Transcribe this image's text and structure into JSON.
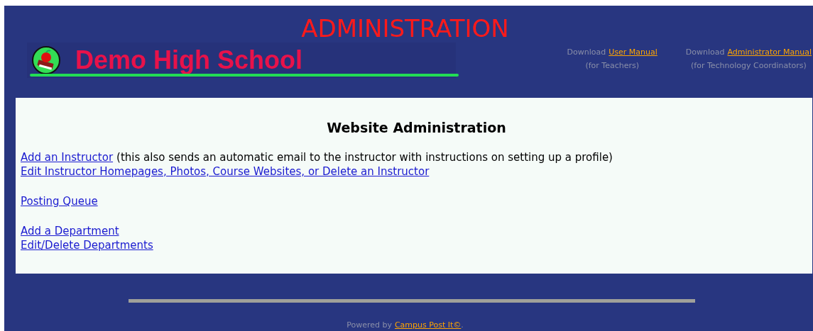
{
  "header": {
    "title": "ADMINISTRATION",
    "logo_text": "Demo High School",
    "downloads": [
      {
        "prefix": "Download",
        "link": "User Manual",
        "note": "(for Teachers)"
      },
      {
        "prefix": "Download",
        "link": "Administrator Manual",
        "note": "(for Technology Coordinators)"
      }
    ]
  },
  "main": {
    "heading": "Website Administration",
    "groups": [
      [
        {
          "link": "Add an Instructor",
          "note": "(this also sends an automatic email to the instructor with instructions on setting up a profile)"
        },
        {
          "link": "Edit Instructor Homepages, Photos, Course Websites, or Delete an Instructor"
        }
      ],
      [
        {
          "link": "Posting Queue"
        }
      ],
      [
        {
          "link": "Add a Department"
        },
        {
          "link": "Edit/Delete Departments"
        }
      ]
    ]
  },
  "footer": {
    "prefix": "Powered by",
    "link": "Campus Post It©",
    "suffix": "."
  }
}
